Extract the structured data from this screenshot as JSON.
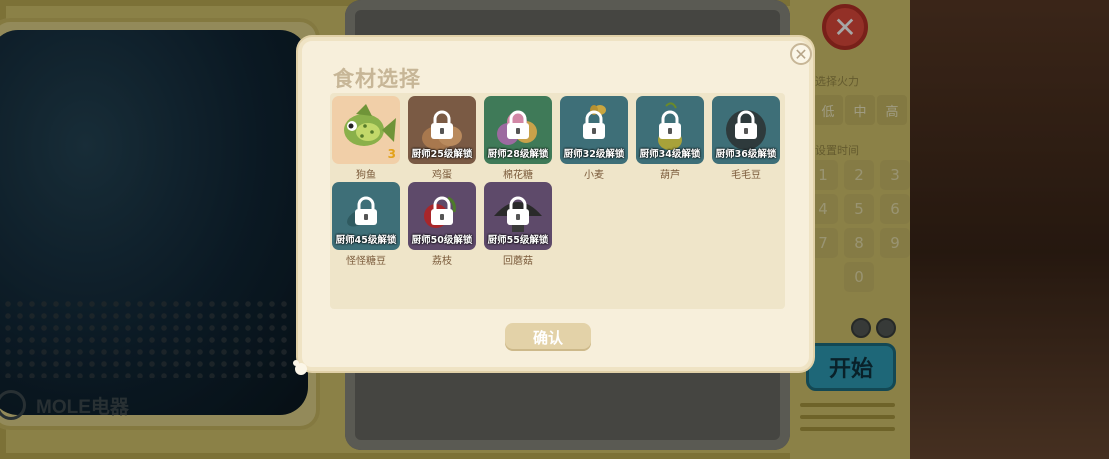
{
  "background": {
    "brand_text": "MOLE电器",
    "fire_label": "选择火力",
    "fire_levels": [
      "低",
      "中",
      "高"
    ],
    "time_label": "设置时间",
    "keypad": [
      "1",
      "2",
      "3",
      "4",
      "5",
      "6",
      "7",
      "8",
      "9",
      "0"
    ],
    "start_label": "开始",
    "close_symbol": "✕"
  },
  "dialog": {
    "title": "食材选择",
    "close_symbol": "✕",
    "confirm_label": "确认",
    "items": [
      {
        "name": "狗鱼",
        "locked": false,
        "count": "3",
        "bg": "#f1cfa8"
      },
      {
        "name": "鸡蛋",
        "locked": true,
        "unlock_text": "厨师25级解锁",
        "bg": "#7a5a44"
      },
      {
        "name": "棉花糖",
        "locked": true,
        "unlock_text": "厨师28级解锁",
        "bg": "#3f7a58"
      },
      {
        "name": "小麦",
        "locked": true,
        "unlock_text": "厨师32级解锁",
        "bg": "#3e6f78"
      },
      {
        "name": "葫芦",
        "locked": true,
        "unlock_text": "厨师34级解锁",
        "bg": "#3e6f78"
      },
      {
        "name": "毛毛豆",
        "locked": true,
        "unlock_text": "厨师36级解锁",
        "bg": "#3e6f78"
      },
      {
        "name": "怪怪糖豆",
        "locked": true,
        "unlock_text": "厨师45级解锁",
        "bg": "#3e6f78"
      },
      {
        "name": "荔枝",
        "locked": true,
        "unlock_text": "厨师50级解锁",
        "bg": "#5e4a6a"
      },
      {
        "name": "回蘑菇",
        "locked": true,
        "unlock_text": "厨师55级解锁",
        "bg": "#5e4a6a"
      }
    ]
  }
}
